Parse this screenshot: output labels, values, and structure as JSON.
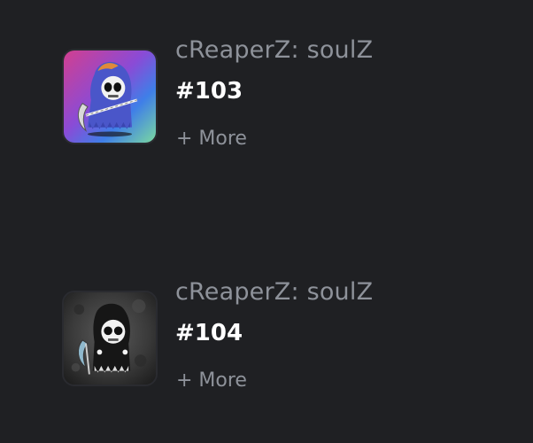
{
  "items": [
    {
      "collection": "cReaperZ: soulZ",
      "token": "#103",
      "more_label": "+ More",
      "image_icon": "reaper-gradient-avatar-icon",
      "colors": {
        "gradient": [
          "#d23f8f",
          "#8a4bd6",
          "#3f7ee8",
          "#7ad9a0"
        ]
      }
    },
    {
      "collection": "cReaperZ: soulZ",
      "token": "#104",
      "more_label": "+ More",
      "image_icon": "reaper-grunge-avatar-icon",
      "colors": {
        "background": "#3b3b3b"
      }
    }
  ],
  "colors": {
    "background": "#1f2023",
    "muted_text": "#8e929a",
    "primary_text": "#ffffff"
  }
}
